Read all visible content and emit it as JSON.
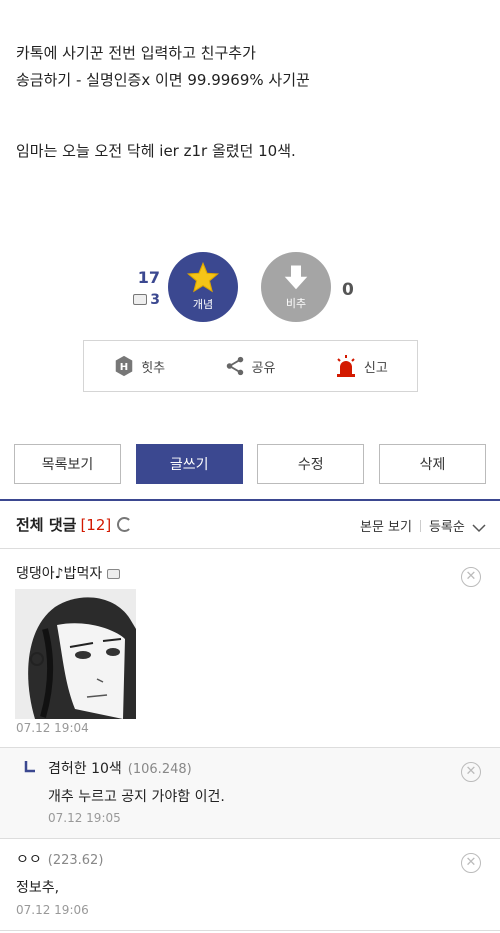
{
  "post": {
    "lines": [
      "카톡에 사기꾼 전번 입력하고 친구추가",
      "송금하기 - 실명인증x 이면 99.9969% 사기꾼",
      "임마는 오늘 오전 닥헤 ier z1r 올렸던 10색."
    ]
  },
  "votes": {
    "up_count": "17",
    "reply_count": "3",
    "up_label": "개념",
    "down_label": "비추",
    "down_count": "0"
  },
  "actions": {
    "hit_label": "힛추",
    "share_label": "공유",
    "report_label": "신고"
  },
  "buttons": {
    "list": "목록보기",
    "write": "글쓰기",
    "edit": "수정",
    "delete": "삭제"
  },
  "comments_header": {
    "title": "전체 댓글",
    "count": "[12]",
    "view_body": "본문 보기",
    "sort": "등록순"
  },
  "comments": [
    {
      "nick": "댕댕아♪밥먹자",
      "date": "07.12 19:04"
    },
    {
      "nick": "겸허한 10색",
      "ip": "(106.248)",
      "text": "개추 누르고 공지 가야함 이건.",
      "date": "07.12 19:05"
    },
    {
      "nick": "ㅇㅇ",
      "ip": "(223.62)",
      "text": "정보추,",
      "date": "07.12 19:06"
    }
  ],
  "colors": {
    "accent": "#3b4890",
    "count_red": "#d31900",
    "down_gray": "#a5a5a5"
  }
}
